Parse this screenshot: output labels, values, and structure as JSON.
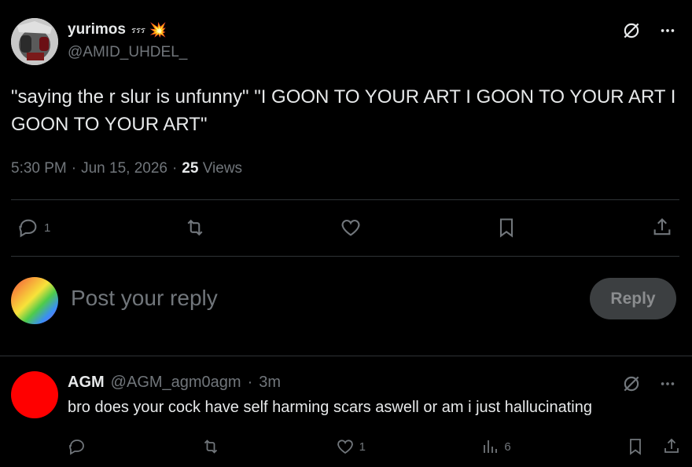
{
  "post": {
    "display_name": "yurimos",
    "name_badge_text": "รรร",
    "name_emoji": "💥",
    "handle": "@AMID_UHDEL_",
    "text": "\"saying the r slur is unfunny\" \"I GOON TO YOUR ART I GOON TO YOUR ART I GOON TO YOUR ART\"",
    "time": "5:30 PM",
    "date": "Jun 15, 2026",
    "views_count": "25",
    "views_label": "Views",
    "separator": "·",
    "reply_count": "1"
  },
  "reply_box": {
    "placeholder": "Post your reply",
    "button_label": "Reply"
  },
  "comment": {
    "display_name": "AGM",
    "handle": "@AGM_agm0agm",
    "separator": "·",
    "time": "3m",
    "text": "bro does your cock have self harming scars aswell or am i just hallucinating",
    "like_count": "1",
    "views_count": "6"
  },
  "icons": {
    "grok": "grok-icon",
    "more": "more-icon",
    "reply": "reply-icon",
    "repost": "repost-icon",
    "like": "heart-icon",
    "bookmark": "bookmark-icon",
    "share": "share-icon",
    "views": "views-icon"
  },
  "colors": {
    "background": "#000000",
    "text": "#e7e9ea",
    "muted": "#71767b",
    "divider": "#2f3336",
    "reply_button_bg": "#3c3f41",
    "comment_avatar": "#ff0000"
  }
}
